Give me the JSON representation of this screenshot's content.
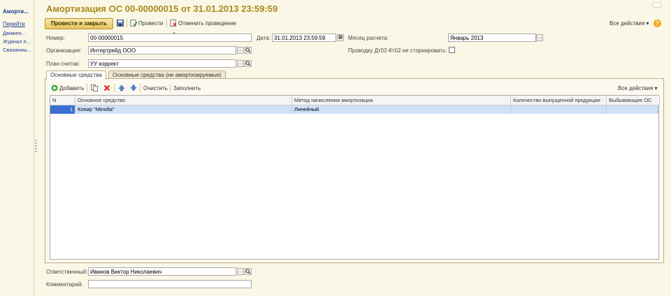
{
  "left_panel": {
    "header": "Аморти...",
    "goto": "Перейти",
    "links": [
      "Движен...",
      "Журнал п...",
      "Связанны..."
    ]
  },
  "window": {
    "title": "Амортизация ОС 00-00000015 от 31.01.2013 23:59:59"
  },
  "toolbar": {
    "post_close": "Провести и закрыть",
    "post": "Провести",
    "cancel_post": "Отменить проведение",
    "all_actions": "Все действия ▾",
    "help": "?"
  },
  "form": {
    "number_label": "Номер:",
    "number_value": "00-00000015",
    "date_label": "Дата:",
    "date_value": "31.01.2013 23:59:59",
    "month_label": "Месяц расчета:",
    "month_value": "Январь 2013",
    "org_label": "Организация:",
    "org_value": "Интертрейд ООО",
    "no_storno_label": "Проводку Дт02-Кт02 не сторнировать:",
    "chart_label": "План счетов:",
    "chart_value": "УУ коррект",
    "responsible_label": "Ответственный:",
    "responsible_value": "Иванов Виктор Николаевич",
    "comment_label": "Комментарий:",
    "comment_value": ""
  },
  "tabs": [
    "Основные средства",
    "Основные средства (не амортизируемые)"
  ],
  "table_toolbar": {
    "add": "Добавить",
    "clear": "Очистить",
    "fill": "Заполнить",
    "all_actions": "Все действия ▾"
  },
  "table": {
    "columns": [
      "N",
      "Основное средство",
      "Метод начисления амортизации",
      "Количество выпущенной продукции",
      "Выбывающее ОС"
    ],
    "rows": [
      [
        "1",
        "Копир \"Minolta\"",
        "Линейный",
        "",
        ""
      ]
    ]
  },
  "colors": {
    "title": "#a88a1c",
    "link": "#1a3b8f",
    "background": "#fbf7e6",
    "selected_row": "#cfe0f7"
  }
}
